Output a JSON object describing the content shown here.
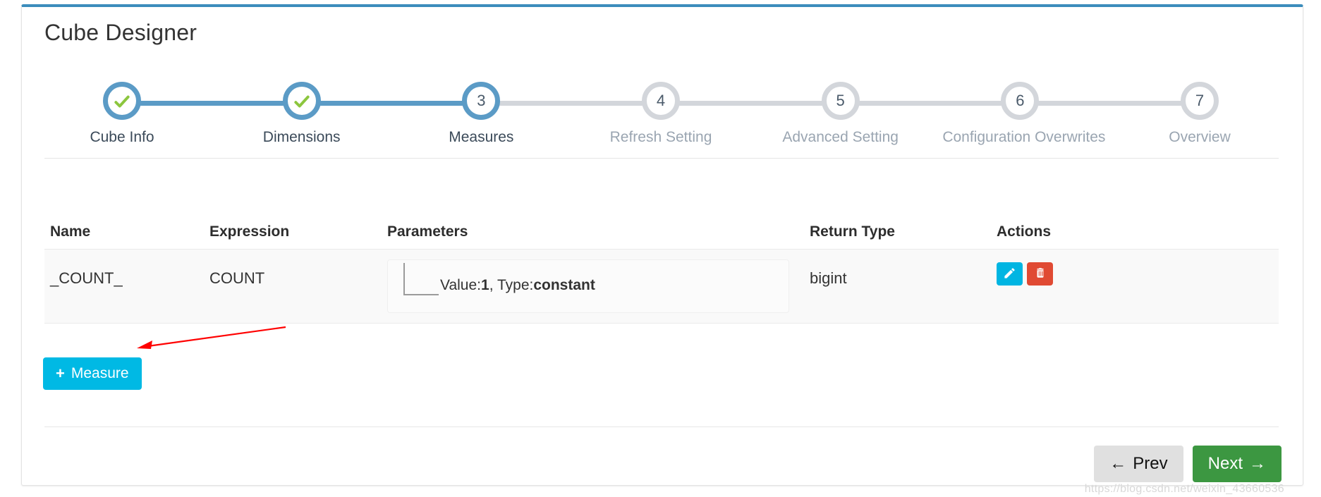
{
  "page": {
    "title": "Cube Designer",
    "accent_blue": "#3c8dbc",
    "step_active_color": "#5b9bc6",
    "step_inactive_color": "#d3d6db"
  },
  "stepper": {
    "current_step": 3,
    "steps": [
      {
        "num": "1",
        "label": "Cube Info",
        "state": "done",
        "icon": "check-icon"
      },
      {
        "num": "2",
        "label": "Dimensions",
        "state": "done",
        "icon": "check-icon"
      },
      {
        "num": "3",
        "label": "Measures",
        "state": "active",
        "icon": ""
      },
      {
        "num": "4",
        "label": "Refresh Setting",
        "state": "pending",
        "icon": ""
      },
      {
        "num": "5",
        "label": "Advanced Setting",
        "state": "pending",
        "icon": ""
      },
      {
        "num": "6",
        "label": "Configuration Overwrites",
        "state": "pending",
        "icon": ""
      },
      {
        "num": "7",
        "label": "Overview",
        "state": "pending",
        "icon": ""
      }
    ]
  },
  "table": {
    "columns": [
      "Name",
      "Expression",
      "Parameters",
      "Return Type",
      "Actions"
    ],
    "rows": [
      {
        "name": "_COUNT_",
        "expression": "COUNT",
        "parameter": {
          "prefix": "Value:",
          "value": "1",
          "separator": ", Type:",
          "type": "constant"
        },
        "return_type": "bigint",
        "actions": {
          "edit_icon": "pencil-icon",
          "edit_color": "#00b5e2",
          "delete_icon": "trash-icon",
          "delete_color": "#e04a33"
        }
      }
    ]
  },
  "toolbar": {
    "add_measure_label": "Measure",
    "add_measure_plus": "+",
    "add_measure_color": "#00b9e4"
  },
  "footer": {
    "prev_label": "Prev",
    "prev_arrow": "←",
    "next_label": "Next",
    "next_arrow": "→",
    "next_color": "#3c9741"
  },
  "watermark": {
    "text": "https://blog.csdn.net/weixin_43660536"
  },
  "annotation": {
    "arrow_color": "#ff0000"
  }
}
